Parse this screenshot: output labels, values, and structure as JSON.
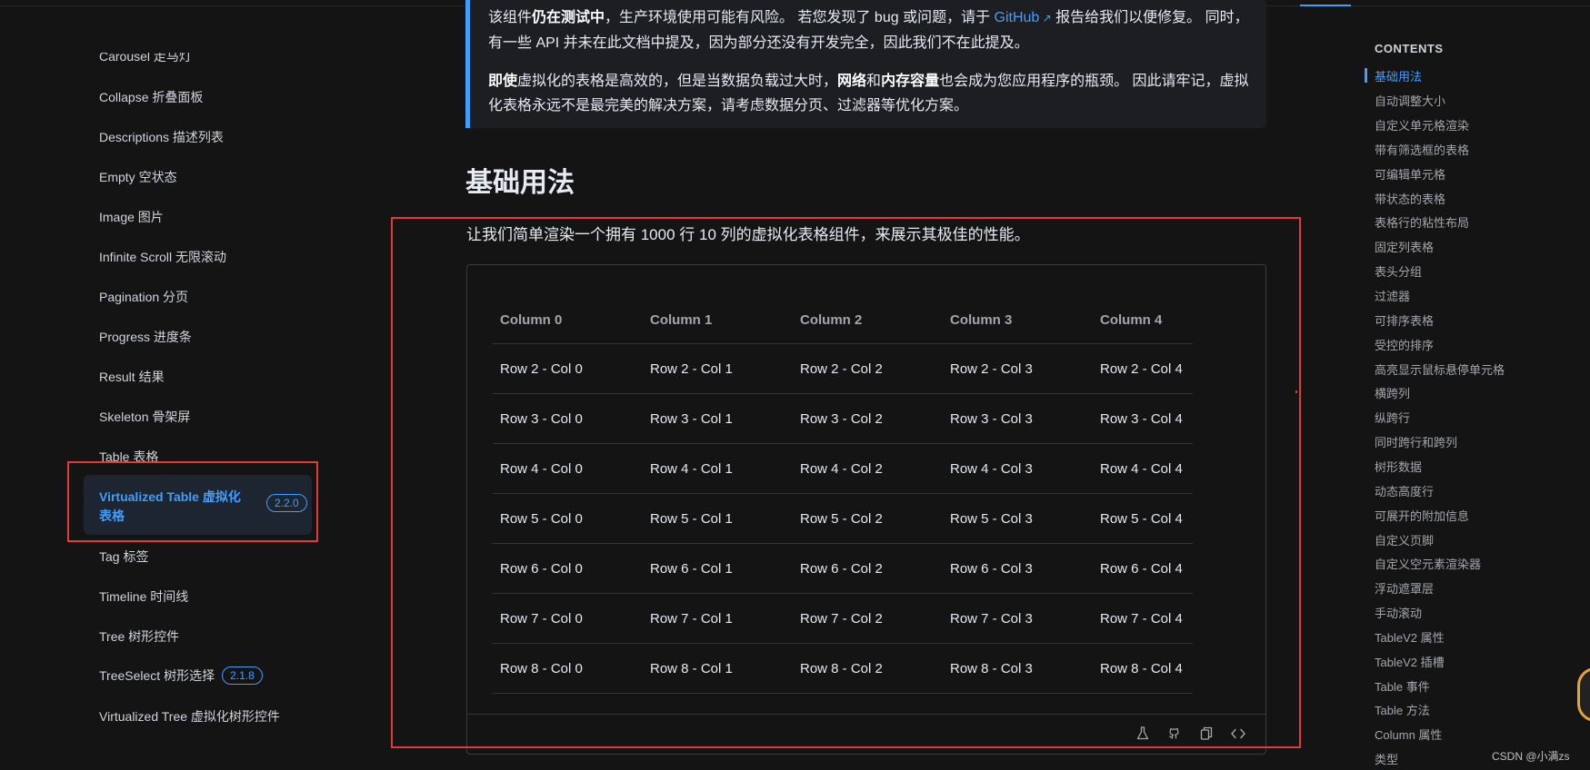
{
  "sidebar": {
    "items": [
      {
        "label": "Carousel 走马灯"
      },
      {
        "label": "Collapse 折叠面板"
      },
      {
        "label": "Descriptions 描述列表"
      },
      {
        "label": "Empty 空状态"
      },
      {
        "label": "Image 图片"
      },
      {
        "label": "Infinite Scroll 无限滚动"
      },
      {
        "label": "Pagination 分页"
      },
      {
        "label": "Progress 进度条"
      },
      {
        "label": "Result 结果"
      },
      {
        "label": "Skeleton 骨架屏"
      },
      {
        "label": "Table 表格"
      }
    ],
    "active": {
      "label": "Virtualized Table 虚拟化表格",
      "badge": "2.2.0"
    },
    "items_after": [
      {
        "label": "Tag 标签"
      },
      {
        "label": "Timeline 时间线"
      },
      {
        "label": "Tree 树形控件"
      },
      {
        "label": "TreeSelect 树形选择",
        "badge": "2.1.8"
      },
      {
        "label": "Virtualized Tree 虚拟化树形控件"
      }
    ]
  },
  "tip": {
    "p1_a": "该组件",
    "p1_b": "仍在测试中",
    "p1_c": "，生产环境使用可能有风险。 若您发现了 bug 或问题，请于 ",
    "p1_link": "GitHub",
    "p1_d": " 报告给我们以便修复。 同时，有一些 API 并未在此文档中提及，因为部分还没有开发完全，因此我们不在此提及。",
    "p2_a": "即使",
    "p2_b": "虚拟化的表格是高效的，但是当数据负载过大时，",
    "p2_c": "网络",
    "p2_d": "和",
    "p2_e": "内存容量",
    "p2_f": "也会成为您应用程序的瓶颈。 因此请牢记，虚拟化表格永远不是最完美的解决方案，请考虑数据分页、过滤器等优化方案。"
  },
  "main": {
    "heading": "基础用法",
    "intro": "让我们简单渲染一个拥有 1000 行 10 列的虚拟化表格组件，来展示其极佳的性能。"
  },
  "table": {
    "columns": [
      "Column 0",
      "Column 1",
      "Column 2",
      "Column 3",
      "Column 4"
    ],
    "rows": [
      [
        "Row 2 - Col 0",
        "Row 2 - Col 1",
        "Row 2 - Col 2",
        "Row 2 - Col 3",
        "Row 2 - Col 4"
      ],
      [
        "Row 3 - Col 0",
        "Row 3 - Col 1",
        "Row 3 - Col 2",
        "Row 3 - Col 3",
        "Row 3 - Col 4"
      ],
      [
        "Row 4 - Col 0",
        "Row 4 - Col 1",
        "Row 4 - Col 2",
        "Row 4 - Col 3",
        "Row 4 - Col 4"
      ],
      [
        "Row 5 - Col 0",
        "Row 5 - Col 1",
        "Row 5 - Col 2",
        "Row 5 - Col 3",
        "Row 5 - Col 4"
      ],
      [
        "Row 6 - Col 0",
        "Row 6 - Col 1",
        "Row 6 - Col 2",
        "Row 6 - Col 3",
        "Row 6 - Col 4"
      ],
      [
        "Row 7 - Col 0",
        "Row 7 - Col 1",
        "Row 7 - Col 2",
        "Row 7 - Col 3",
        "Row 7 - Col 4"
      ],
      [
        "Row 8 - Col 0",
        "Row 8 - Col 1",
        "Row 8 - Col 2",
        "Row 8 - Col 3",
        "Row 8 - Col 4"
      ]
    ]
  },
  "demo_footer_icons": [
    "flask-icon",
    "github-icon",
    "copy-icon",
    "code-icon"
  ],
  "toc": {
    "title": "CONTENTS",
    "items": [
      "基础用法",
      "自动调整大小",
      "自定义单元格渲染",
      "带有筛选框的表格",
      "可编辑单元格",
      "带状态的表格",
      "表格行的粘性布局",
      "固定列表格",
      "表头分组",
      "过滤器",
      "可排序表格",
      "受控的排序",
      "高亮显示鼠标悬停单元格",
      "横跨列",
      "纵跨行",
      "同时跨行和跨列",
      "树形数据",
      "动态高度行",
      "可展开的附加信息",
      "自定义页脚",
      "自定义空元素渲染器",
      "浮动遮罩层",
      "手动滚动",
      "TableV2 属性",
      "TableV2 插槽",
      "Table 事件",
      "Table 方法",
      "Column 属性",
      "类型"
    ]
  },
  "watermark": "CSDN @小满zs",
  "colors": {
    "accent": "#409eff",
    "annotation": "#e03b3b",
    "background": "#141414"
  }
}
